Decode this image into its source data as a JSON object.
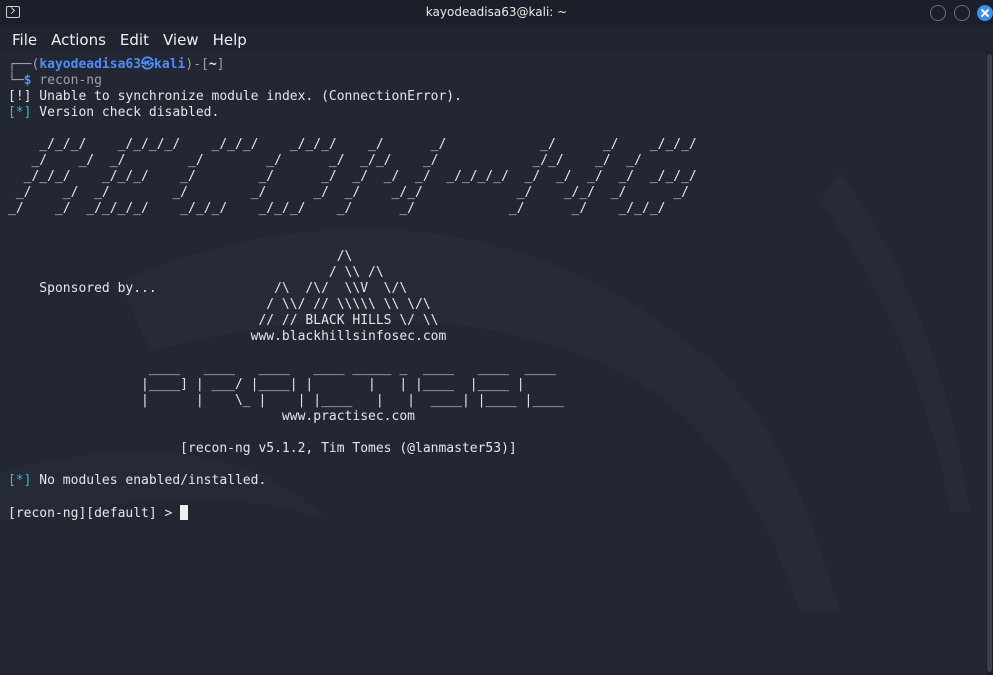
{
  "window": {
    "title": "kayodeadisa63@kali: ~"
  },
  "menu": [
    "File",
    "Actions",
    "Edit",
    "View",
    "Help"
  ],
  "prompt": {
    "corner_top": "┌──(",
    "user": "kayodeadisa63㉿kali",
    "mid": ")-[",
    "path": "~",
    "end": "]",
    "corner_bottom": "└─",
    "dollar": "$ ",
    "command": "recon-ng"
  },
  "output": {
    "error_tag": "[!]",
    "error_text": " Unable to synchronize module index. (ConnectionError).",
    "info_tag": "[*]",
    "info_text": " Version check disabled.",
    "banner": [
      "    _/_/_/    _/_/_/_/    _/_/_/    _/_/_/    _/      _/            _/      _/    _/_/_/",
      "   _/    _/  _/        _/        _/      _/  _/_/    _/            _/_/    _/  _/",
      "  _/_/_/    _/_/_/    _/        _/      _/  _/  _/  _/  _/_/_/_/  _/  _/  _/  _/  _/_/_/",
      " _/    _/  _/        _/        _/      _/  _/    _/_/            _/    _/_/  _/      _/",
      "_/    _/  _/_/_/_/    _/_/_/    _/_/_/    _/      _/            _/      _/    _/_/_/"
    ],
    "bhis_art": [
      "                                          /\\",
      "                                         / \\\\ /\\",
      "    Sponsored by...               /\\  /\\/  \\\\V  \\/\\",
      "                                 / \\\\/ // \\\\\\\\\\ \\\\ \\/\\",
      "                                // // BLACK HILLS \\/ \\\\",
      "                               www.blackhillsinfosec.com"
    ],
    "practisec_art": [
      "                  ____   ____   ____   ____ _____ _  ____   ____  ____",
      "                 |____] | ___/ |____| |       |   | |____  |____ |",
      "                 |      |    \\_ |    | |____   |   |  ____| |____ |____",
      "                                   www.practisec.com"
    ],
    "version_line": "                      [recon-ng v5.1.2, Tim Tomes (@lanmaster53)]",
    "modules_tag": "[*]",
    "modules_text": " No modules enabled/installed.",
    "shell_prompt": "[recon-ng][default] > "
  },
  "colors": {
    "terminal_bg": "#222733",
    "prompt_blue": "#4d8ef7",
    "error_red": "#d13f3f",
    "info_cyan": "#3fb7c7",
    "version_orange": "#e08a2e"
  }
}
